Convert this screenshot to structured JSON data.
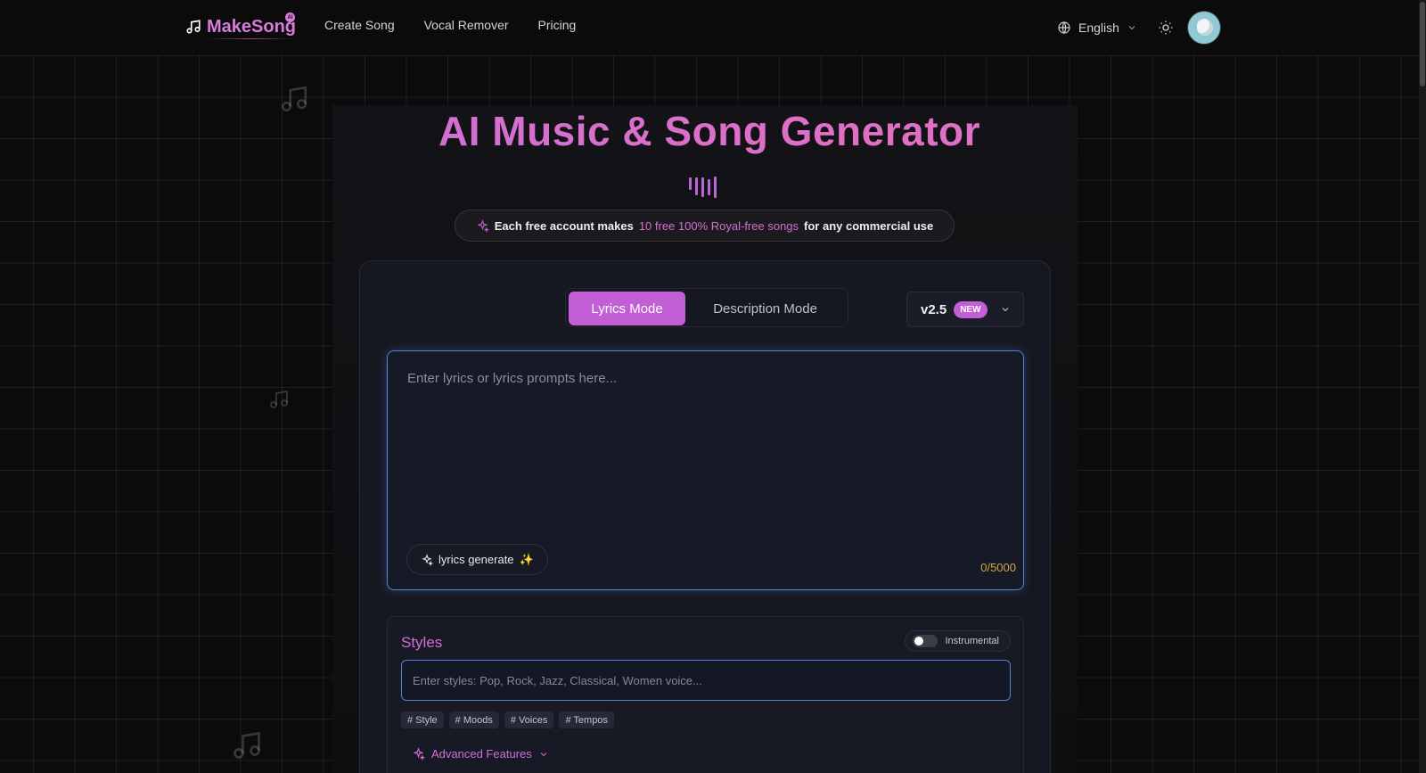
{
  "brand": {
    "name": "MakeSong",
    "badge": "AI"
  },
  "nav": [
    "Create Song",
    "Vocal Remover",
    "Pricing"
  ],
  "header": {
    "language": "English"
  },
  "hero": {
    "title": "AI Music & Song Generator",
    "promo_prefix": "Each free account makes",
    "promo_highlight": "10 free 100% Royal-free songs",
    "promo_suffix": "for any commercial use"
  },
  "modes": {
    "active": "Lyrics Mode",
    "inactive": "Description Mode"
  },
  "version": {
    "label": "v2.5",
    "badge": "NEW"
  },
  "lyrics": {
    "placeholder": "Enter lyrics or lyrics prompts here...",
    "generate_label": "lyrics generate",
    "generate_spark": "✨",
    "counter": "0/5000"
  },
  "styles": {
    "title": "Styles",
    "instrumental_label": "Instrumental",
    "placeholder": "Enter styles: Pop, Rock, Jazz, Classical, Women voice...",
    "tags": [
      "# Style",
      "# Moods",
      "# Voices",
      "# Tempos"
    ],
    "advanced_label": "Advanced Features"
  },
  "colors": {
    "accent": "#c25fd6",
    "focus": "#5a7fcf",
    "counter": "#d6a548"
  }
}
